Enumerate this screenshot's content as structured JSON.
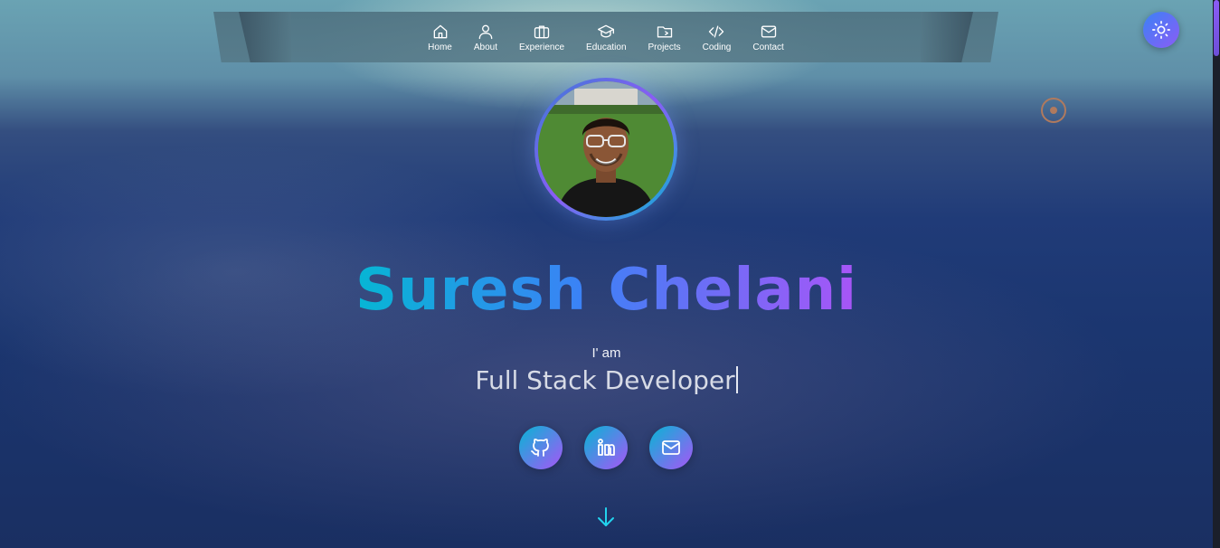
{
  "nav": {
    "items": [
      {
        "label": "Home",
        "icon": "home-icon"
      },
      {
        "label": "About",
        "icon": "user-icon"
      },
      {
        "label": "Experience",
        "icon": "briefcase-icon"
      },
      {
        "label": "Education",
        "icon": "graduation-cap-icon"
      },
      {
        "label": "Projects",
        "icon": "folder-icon"
      },
      {
        "label": "Coding",
        "icon": "code-icon"
      },
      {
        "label": "Contact",
        "icon": "mail-icon"
      }
    ]
  },
  "theme_toggle": {
    "icon": "sun-icon"
  },
  "hero": {
    "name": "Suresh Chelani",
    "intro": "I' am",
    "role": "Full Stack Developer",
    "avatar_icon": "profile-photo"
  },
  "social": [
    {
      "icon": "github-icon"
    },
    {
      "icon": "linkedin-icon"
    },
    {
      "icon": "mail-icon"
    }
  ],
  "scroll_icon": "arrow-down-icon",
  "colors": {
    "gradient_start": "#06b6d4",
    "gradient_mid": "#3b82f6",
    "gradient_end": "#a855f7",
    "scroll_arrow": "#22d3ee"
  }
}
